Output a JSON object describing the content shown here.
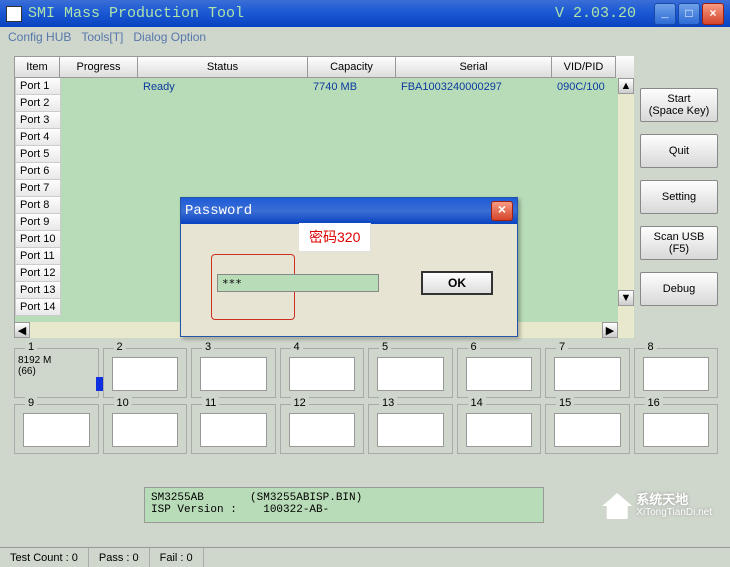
{
  "window": {
    "title": "SMI Mass Production Tool",
    "version": "V 2.03.20"
  },
  "menu": {
    "config_hub": "Config HUB",
    "tools": "Tools[T]",
    "dialog_option": "Dialog Option"
  },
  "grid": {
    "headers": {
      "item": "Item",
      "progress": "Progress",
      "status": "Status",
      "capacity": "Capacity",
      "serial": "Serial",
      "vidpid": "VID/PID"
    },
    "rows": [
      {
        "item": "Port 1",
        "progress": "",
        "status": "Ready",
        "capacity": "7740 MB",
        "serial": "FBA1003240000297",
        "vidpid": "090C/100"
      },
      {
        "item": "Port 2",
        "progress": "",
        "status": "",
        "capacity": "",
        "serial": "",
        "vidpid": ""
      },
      {
        "item": "Port 3",
        "progress": "",
        "status": "",
        "capacity": "",
        "serial": "",
        "vidpid": ""
      },
      {
        "item": "Port 4",
        "progress": "",
        "status": "",
        "capacity": "",
        "serial": "",
        "vidpid": ""
      },
      {
        "item": "Port 5",
        "progress": "",
        "status": "",
        "capacity": "",
        "serial": "",
        "vidpid": ""
      },
      {
        "item": "Port 6",
        "progress": "",
        "status": "",
        "capacity": "",
        "serial": "",
        "vidpid": ""
      },
      {
        "item": "Port 7",
        "progress": "",
        "status": "",
        "capacity": "",
        "serial": "",
        "vidpid": ""
      },
      {
        "item": "Port 8",
        "progress": "",
        "status": "",
        "capacity": "",
        "serial": "",
        "vidpid": ""
      },
      {
        "item": "Port 9",
        "progress": "",
        "status": "",
        "capacity": "",
        "serial": "",
        "vidpid": ""
      },
      {
        "item": "Port 10",
        "progress": "",
        "status": "",
        "capacity": "",
        "serial": "",
        "vidpid": ""
      },
      {
        "item": "Port 11",
        "progress": "",
        "status": "",
        "capacity": "",
        "serial": "",
        "vidpid": ""
      },
      {
        "item": "Port 12",
        "progress": "",
        "status": "",
        "capacity": "",
        "serial": "",
        "vidpid": ""
      },
      {
        "item": "Port 13",
        "progress": "",
        "status": "",
        "capacity": "",
        "serial": "",
        "vidpid": ""
      },
      {
        "item": "Port 14",
        "progress": "",
        "status": "",
        "capacity": "",
        "serial": "",
        "vidpid": ""
      }
    ]
  },
  "side_buttons": {
    "start": "Start\n(Space Key)",
    "quit": "Quit",
    "setting": "Setting",
    "scan_usb": "Scan USB\n(F5)",
    "debug": "Debug"
  },
  "slots": {
    "numbers": [
      "1",
      "2",
      "3",
      "4",
      "5",
      "6",
      "7",
      "8",
      "9",
      "10",
      "11",
      "12",
      "13",
      "14",
      "15",
      "16"
    ],
    "slot1": {
      "size": "8192 M",
      "count": "(66)"
    }
  },
  "info": {
    "line1": "SM3255AB       (SM3255ABISP.BIN)",
    "line2": "ISP Version :    100322-AB-"
  },
  "status": {
    "test_count": "Test Count :  0",
    "pass": "Pass :  0",
    "fail": "Fail :  0"
  },
  "dialog": {
    "title": "Password",
    "annotation": "密码320",
    "input_value": "***",
    "ok": "OK"
  },
  "watermark": {
    "line1": "系统天地",
    "line2": "XiTongTianDi.net"
  }
}
